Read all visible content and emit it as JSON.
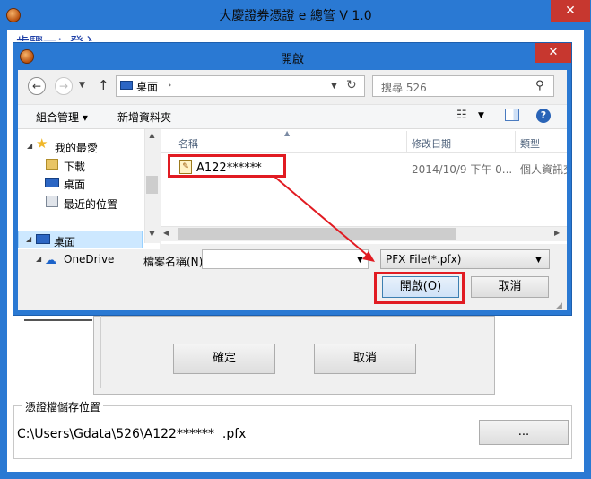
{
  "main_window": {
    "title": "大慶證券憑證 e 總管 V 1.0",
    "close_glyph": "✕",
    "step_label": "步驟一：登入"
  },
  "login_dialog": {
    "ok_label": "確定",
    "cancel_label": "取消"
  },
  "save_location": {
    "group_title": "憑證檔儲存位置",
    "path": "C:\\Users\\Gdata\\526\\A122******  .pfx",
    "browse_label": "..."
  },
  "open_dialog": {
    "title": "開啟",
    "close_glyph": "✕",
    "address": "桌面",
    "address_chevron": "›",
    "search_placeholder": "搜尋 526",
    "toolbar": {
      "organize_label": "組合管理 ▾",
      "new_folder_label": "新增資料夾"
    },
    "nav_pane": {
      "favorites": "我的最愛",
      "downloads": "下載",
      "desktop": "桌面",
      "recent": "最近的位置",
      "desktop_root": "桌面",
      "onedrive": "OneDrive"
    },
    "columns": {
      "name": "名稱",
      "date_modified": "修改日期",
      "type": "類型"
    },
    "files": [
      {
        "name": "A122******",
        "date": "2014/10/9 下午 0...",
        "type": "個人資訊交換"
      }
    ],
    "filename_label": "檔案名稱(N):",
    "filename_value": "",
    "filetype_value": "PFX File(*.pfx)",
    "open_label": "開啟(O)",
    "cancel_label": "取消"
  },
  "colors": {
    "title_bar": "#2a79d3",
    "close_button": "#c7372f",
    "annotation_red": "#e11b22",
    "selection": "#cde8ff"
  }
}
